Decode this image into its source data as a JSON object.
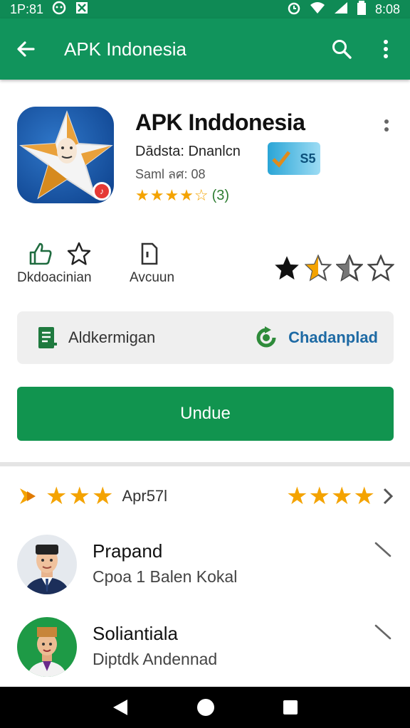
{
  "status_bar": {
    "time_left": "1P:81",
    "time_right": "8:08"
  },
  "app_bar": {
    "title": "APK Indonesia"
  },
  "app": {
    "name": "APK Inddonesia",
    "developer": "Dādsta: Dnanlcn",
    "size": "Saml ลศ: 08",
    "rating_count": "(3)",
    "badge_text": "S5"
  },
  "actions": [
    {
      "label": "Dkdoacinian"
    },
    {
      "label": "Avcuun"
    }
  ],
  "info_card": {
    "left_label": "Aldkermigan",
    "right_label": "Chadanplad"
  },
  "install": {
    "label": "Undue"
  },
  "reviews_header": {
    "date": "Apr57l"
  },
  "reviews": [
    {
      "name": "Prapand",
      "text": "Cpoa 1 Balen Kokal"
    },
    {
      "name": "Soliantiala",
      "text": "Diptdk Andennad"
    }
  ],
  "colors": {
    "primary": "#11945c",
    "install": "#11944f",
    "star": "#f4a300",
    "link": "#1e6aa4"
  },
  "icons": [
    "back-arrow-icon",
    "search-icon",
    "more-vert-icon",
    "thumb-up-icon",
    "star-outline-icon",
    "document-icon",
    "list-doc-icon",
    "refresh-icon",
    "chevron-right-icon",
    "expand-icon",
    "nav-back-icon",
    "nav-home-icon",
    "nav-recents-icon"
  ]
}
